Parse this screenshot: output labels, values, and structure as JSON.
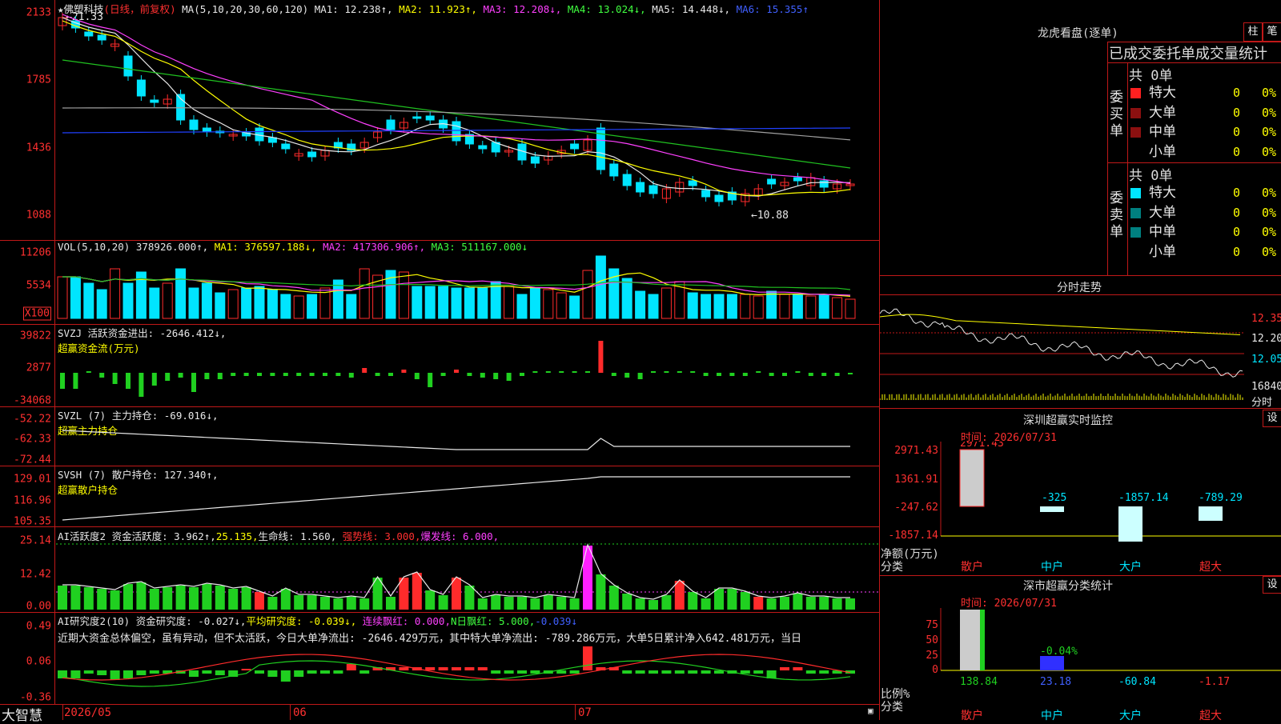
{
  "colors": {
    "up": "#ff2b2b",
    "down": "#00e5ff",
    "grid": "#c01818",
    "ma1": "#e8e8e8",
    "ma2": "#ffff00",
    "ma3": "#ff40ff",
    "ma4": "#20c020",
    "ma5": "#a0a0a0",
    "ma6": "#2040ff"
  },
  "main": {
    "axis": [
      "2133",
      "1785",
      "1436",
      "1088"
    ],
    "title": {
      "star": "★",
      "name": "佛塑科技",
      "period": "(日线，前复权)",
      "ma_label": "MA(5,10,20,30,60,120)",
      "ma1": "MA1: 12.238↑,",
      "ma2": "MA2: 11.923↑,",
      "ma3": "MA3: 12.208↓,",
      "ma4": "MA4: 13.024↓,",
      "ma5": "MA5: 14.448↓,",
      "ma6": "MA6: 15.355↑"
    },
    "high_label": "←21.33",
    "low_label": "←10.88"
  },
  "vol": {
    "axis": [
      "11206",
      "5534",
      "X100"
    ],
    "title": {
      "label": "VOL(5,10,20)",
      "value": "378926.000↑,",
      "ma1": "MA1: 376597.188↓,",
      "ma2": "MA2: 417306.906↑,",
      "ma3": "MA3: 511167.000↓"
    }
  },
  "svzj": {
    "axis": [
      "39822",
      "2877",
      "-34068"
    ],
    "title": "SVZJ  活跃资金进出: -2646.412↓,",
    "subtitle": "超赢资金流(万元)"
  },
  "svzl": {
    "axis": [
      "-52.22",
      "-62.33",
      "-72.44"
    ],
    "title": "SVZL (7) 主力持仓: -69.016↓,",
    "subtitle": "超赢主力持仓"
  },
  "svsh": {
    "axis": [
      "129.01",
      "116.96",
      "105.35"
    ],
    "title": "SVSH (7) 散户持仓: 127.340↑,",
    "subtitle": "超赢散户持仓"
  },
  "ai1": {
    "axis": [
      "25.14",
      "12.42",
      "0.00"
    ],
    "title_a": "AI活跃度2 资金活跃度: 3.962↑,",
    "title_b": "25.135,",
    "title_c": "生命线: 1.560,",
    "title_d": "强势线: 3.000,",
    "title_e": "爆发线: 6.000,"
  },
  "ai2": {
    "axis": [
      "0.49",
      "0.06",
      "-0.36"
    ],
    "title_a": "AI研究度2(10) 资金研究度: -0.027↓,",
    "title_b": "平均研究度: -0.039↓,",
    "title_c": "连续飘红: 0.000,",
    "title_d": "N日飘红: 5.000,",
    "title_e": "-0.039↓",
    "comment": "近期大资金总体偏空，虽有异动，但不太活跃，今日大单净流出: -2646.429万元，其中特大单净流出: -789.286万元，大单5日累计净入642.481万元，当日"
  },
  "bottom": {
    "brand": "大智慧",
    "d1": "2026/05",
    "d2": "06",
    "d3": "07"
  },
  "right": {
    "lhb_title": "龙虎看盘(逐单)",
    "btn_zhu": "柱",
    "btn_bi": "笔",
    "deal_header": "已成交委托单成交量统计",
    "buy_label": "委买单",
    "sell_label": "委卖单",
    "buy_total": "共 0单",
    "sell_total": "共 0单",
    "buy_rows": [
      {
        "name": "特大",
        "count": "0",
        "pct": "0%"
      },
      {
        "name": "大单",
        "count": "0",
        "pct": "0%"
      },
      {
        "name": "中单",
        "count": "0",
        "pct": "0%"
      },
      {
        "name": "小单",
        "count": "0",
        "pct": "0%"
      }
    ],
    "sell_rows": [
      {
        "name": "特大",
        "count": "0",
        "pct": "0%"
      },
      {
        "name": "大单",
        "count": "0",
        "pct": "0%"
      },
      {
        "name": "中单",
        "count": "0",
        "pct": "0%"
      },
      {
        "name": "小单",
        "count": "0",
        "pct": "0%"
      }
    ],
    "fs_title": "分时走势",
    "fs_axis": [
      "12.35",
      "12.20",
      "12.05"
    ],
    "fs_vol": "16840",
    "fs_vol_label": "分时",
    "sz_title": "深圳超赢实时监控",
    "btn_set": "设",
    "sz_time": "时间: 2026/07/31",
    "sz_axis": [
      "2971.43",
      "1361.91",
      "-247.62",
      "-1857.14"
    ],
    "sz_values": [
      "2971.43",
      "-325",
      "-1857.14",
      "-789.29"
    ],
    "sz_unit": "净额(万元)",
    "sz_cat": "分类",
    "cats": [
      "散户",
      "中户",
      "大户",
      "超大"
    ],
    "cls_title": "深市超赢分类统计",
    "cls_time": "时间: 2026/07/31",
    "cls_axis": [
      "75",
      "50",
      "25",
      "0"
    ],
    "cls_mid_label": "-0.04%",
    "cls_values": [
      "138.84",
      "23.18",
      "-60.84",
      "-1.17"
    ],
    "cls_unit": "比例%",
    "cls_cat": "分类"
  }
}
